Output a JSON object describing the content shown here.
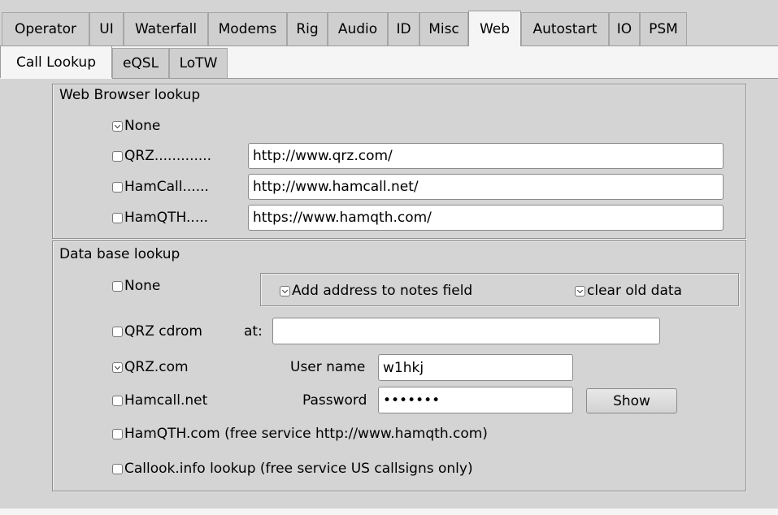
{
  "tabs_main": [
    "Operator",
    "UI",
    "Waterfall",
    "Modems",
    "Rig",
    "Audio",
    "ID",
    "Misc",
    "Web",
    "Autostart",
    "IO",
    "PSM"
  ],
  "tabs_main_selected": "Web",
  "tabs_sub": [
    "Call Lookup",
    "eQSL",
    "LoTW"
  ],
  "tabs_sub_selected": "Call Lookup",
  "web_lookup": {
    "title": "Web Browser lookup",
    "none_label": "None",
    "none_checked": true,
    "qrz_label": "QRZ.............",
    "qrz_checked": false,
    "qrz_url": "http://www.qrz.com/",
    "hamcall_label": "HamCall......",
    "hamcall_checked": false,
    "hamcall_url": "http://www.hamcall.net/",
    "hamqth_label": "HamQTH.....",
    "hamqth_checked": false,
    "hamqth_url": "https://www.hamqth.com/"
  },
  "db_lookup": {
    "title": "Data base lookup",
    "none_label": "None",
    "none_checked": false,
    "add_address_label": "Add address to notes field",
    "add_address_checked": true,
    "clear_old_label": "clear old data",
    "clear_old_checked": true,
    "qrz_cdrom_label": "QRZ cdrom",
    "qrz_cdrom_checked": false,
    "at_label": "at:",
    "at_value": "",
    "qrzcom_label": "QRZ.com",
    "qrzcom_checked": true,
    "username_label": "User name",
    "username_value": "w1hkj",
    "hamcallnet_label": "Hamcall.net",
    "hamcallnet_checked": false,
    "password_label": "Password",
    "password_value": "•••••••",
    "show_button": "Show",
    "hamqthcom_label": "HamQTH.com (free service http://www.hamqth.com)",
    "hamqthcom_checked": false,
    "callook_label": "Callook.info lookup (free service US callsigns only)",
    "callook_checked": false
  }
}
